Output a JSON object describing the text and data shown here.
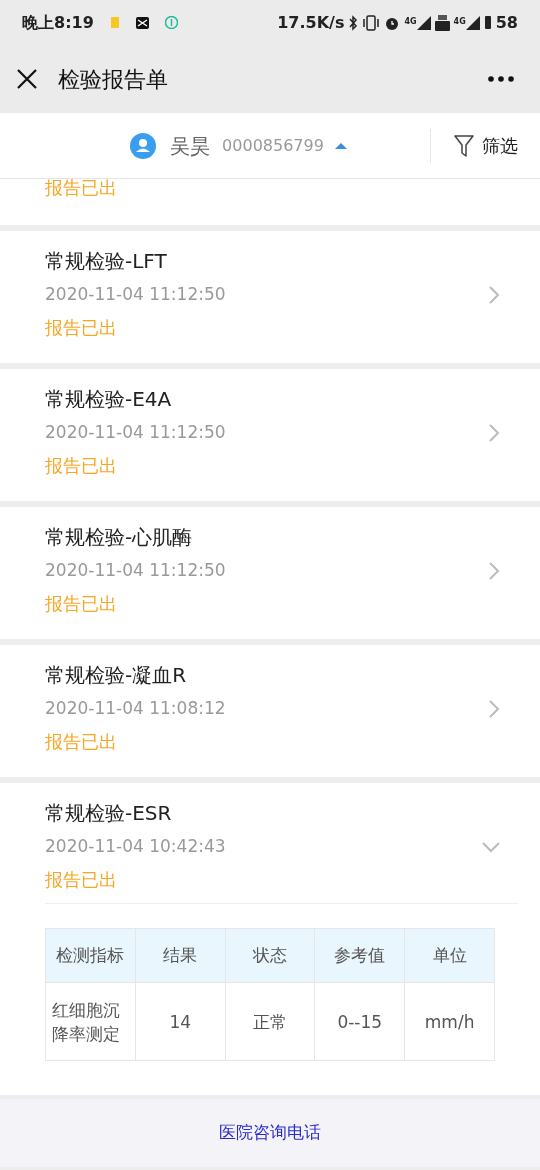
{
  "status_bar": {
    "time": "晚上8:19",
    "speed": "17.5K/s",
    "network_labels": [
      "4G",
      "4G"
    ],
    "battery": "58"
  },
  "header": {
    "title": "检验报告单"
  },
  "patient": {
    "name": "吴昊",
    "id": "0000856799",
    "filter": "筛选"
  },
  "partial_item": {
    "status": "报告已出"
  },
  "reports": [
    {
      "title": "常规检验-LFT",
      "time": "2020-11-04 11:12:50",
      "status": "报告已出",
      "expanded": false
    },
    {
      "title": "常规检验-E4A",
      "time": "2020-11-04 11:12:50",
      "status": "报告已出",
      "expanded": false
    },
    {
      "title": "常规检验-心肌酶",
      "time": "2020-11-04 11:12:50",
      "status": "报告已出",
      "expanded": false
    },
    {
      "title": "常规检验-凝血R",
      "time": "2020-11-04 11:08:12",
      "status": "报告已出",
      "expanded": false
    },
    {
      "title": "常规检验-ESR",
      "time": "2020-11-04 10:42:43",
      "status": "报告已出",
      "expanded": true,
      "table": {
        "columns": [
          "检测指标",
          "结果",
          "状态",
          "参考值",
          "单位"
        ],
        "rows": [
          [
            "红细胞沉降率测定",
            "14",
            "正常",
            "0--15",
            "mm/h"
          ]
        ]
      }
    }
  ],
  "footer": {
    "link": "医院咨询电话"
  }
}
